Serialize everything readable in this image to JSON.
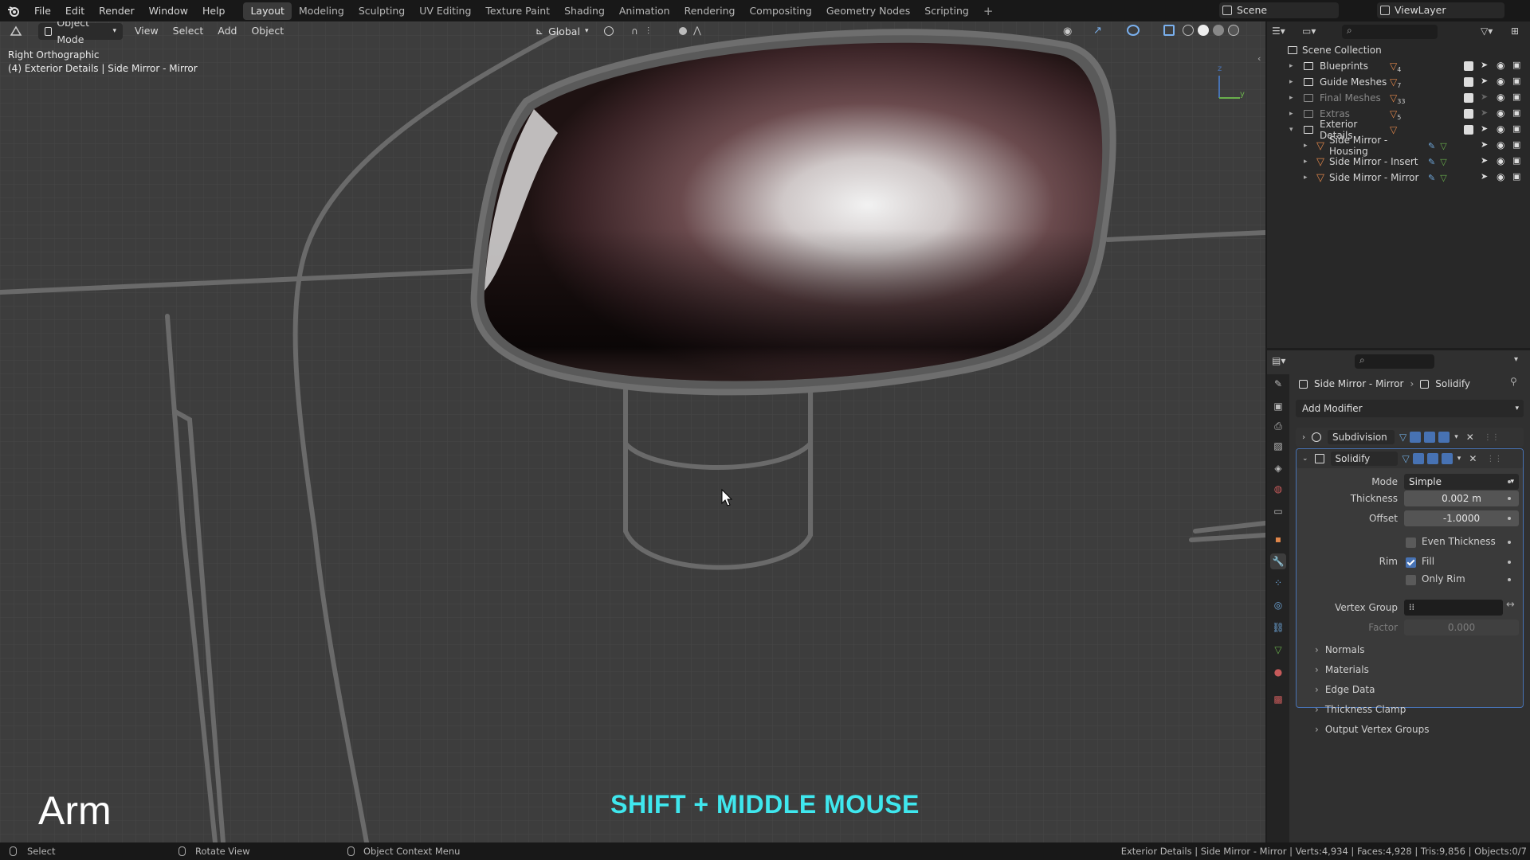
{
  "top_menu": [
    "File",
    "Edit",
    "Render",
    "Window",
    "Help"
  ],
  "workspace_tabs": [
    {
      "label": "Layout",
      "active": true
    },
    {
      "label": "Modeling"
    },
    {
      "label": "Sculpting"
    },
    {
      "label": "UV Editing"
    },
    {
      "label": "Texture Paint"
    },
    {
      "label": "Shading"
    },
    {
      "label": "Animation"
    },
    {
      "label": "Rendering"
    },
    {
      "label": "Compositing"
    },
    {
      "label": "Geometry Nodes"
    },
    {
      "label": "Scripting"
    }
  ],
  "scene_name": "Scene",
  "view_layer": "ViewLayer",
  "viewport": {
    "mode": "Object Mode",
    "menus": [
      "View",
      "Select",
      "Add",
      "Object"
    ],
    "transform_orientation": "Global",
    "view_name": "Right Orthographic",
    "object_info": "(4) Exterior Details | Side Mirror - Mirror",
    "axis_labels": {
      "z": "z",
      "y": "y"
    },
    "overlay_text": "Arm",
    "shortcut_text": "SHIFT + MIDDLE MOUSE"
  },
  "outliner": {
    "root": "Scene Collection",
    "collections": [
      {
        "name": "Blueprints",
        "count": "4",
        "dim": false
      },
      {
        "name": "Guide Meshes",
        "count": "7",
        "dim": false
      },
      {
        "name": "Final Meshes",
        "count": "33",
        "dim": true
      },
      {
        "name": "Extras",
        "count": "5",
        "dim": true
      },
      {
        "name": "Exterior Details",
        "count": "",
        "dim": false,
        "expanded": true
      }
    ],
    "objects": [
      "Side Mirror - Housing",
      "Side Mirror - Insert",
      "Side Mirror - Mirror"
    ]
  },
  "properties": {
    "breadcrumb_object": "Side Mirror - Mirror",
    "breadcrumb_modifier": "Solidify",
    "add_modifier": "Add Modifier",
    "modifiers": [
      {
        "name": "Subdivision",
        "expanded": false
      },
      {
        "name": "Solidify",
        "expanded": true
      }
    ],
    "solidify": {
      "mode_label": "Mode",
      "mode_value": "Simple",
      "thickness_label": "Thickness",
      "thickness_value": "0.002 m",
      "offset_label": "Offset",
      "offset_value": "-1.0000",
      "even_thickness_label": "Even Thickness",
      "even_thickness": false,
      "rim_label": "Rim",
      "fill_label": "Fill",
      "fill": true,
      "only_rim_label": "Only Rim",
      "only_rim": false,
      "vertex_group_label": "Vertex Group",
      "vertex_group_value": "",
      "factor_label": "Factor",
      "factor_value": "0.000"
    },
    "subpanels": [
      "Normals",
      "Materials",
      "Edge Data",
      "Thickness Clamp",
      "Output Vertex Groups"
    ]
  },
  "statusbar": {
    "select": "Select",
    "rotate": "Rotate View",
    "context": "Object Context Menu",
    "stats": "Exterior Details | Side Mirror - Mirror | Verts:4,934 | Faces:4,928 | Tris:9,856 | Objects:0/7"
  },
  "colors": {
    "accent_blue": "#4772b3",
    "shortcut_cyan": "#3fe7ee",
    "object_orange": "#e0864a",
    "modifier_blue": "#6fa8dc",
    "viewport_bg": "#3d3d3d"
  }
}
